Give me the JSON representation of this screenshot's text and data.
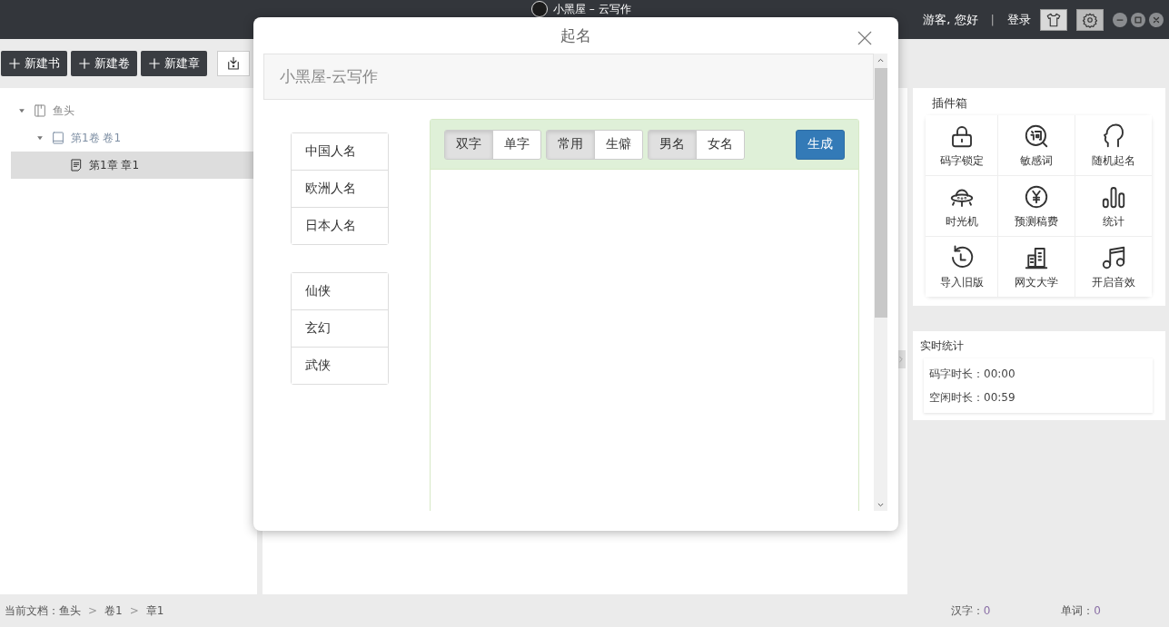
{
  "window": {
    "title": "小黑屋 – 云写作",
    "greeting": "游客, 您好",
    "separator": "|",
    "login": "登录"
  },
  "toolbar": [
    {
      "label": "新建书"
    },
    {
      "label": "新建卷"
    },
    {
      "label": "新建章"
    }
  ],
  "tree": [
    {
      "label": "鱼头",
      "kind": "book",
      "expanded": true,
      "selected": false,
      "children": [
        {
          "label": "第1卷 卷1",
          "kind": "volume",
          "expanded": true,
          "selected": false,
          "children": [
            {
              "label": "第1章 章1",
              "kind": "chapter",
              "selected": true
            }
          ]
        }
      ]
    }
  ],
  "plugins": {
    "title": "插件箱",
    "items": [
      {
        "label": "码字锁定",
        "kind": "lock"
      },
      {
        "label": "敏感词",
        "kind": "word"
      },
      {
        "label": "随机起名",
        "kind": "head"
      },
      {
        "label": "时光机",
        "kind": "ufo"
      },
      {
        "label": "预测稿费",
        "kind": "yen"
      },
      {
        "label": "统计",
        "kind": "bars"
      },
      {
        "label": "导入旧版",
        "kind": "history"
      },
      {
        "label": "网文大学",
        "kind": "building"
      },
      {
        "label": "开启音效",
        "kind": "music"
      }
    ]
  },
  "stats": {
    "title": "实时统计",
    "rows": [
      {
        "label": "码字时长：",
        "value": "00:00"
      },
      {
        "label": "空闲时长：",
        "value": "00:59"
      }
    ]
  },
  "status_bar": {
    "path_label": "当前文档：",
    "path": [
      "鱼头",
      "卷1",
      "章1"
    ],
    "separator": ">",
    "counts": [
      {
        "label": "汉字：",
        "value": "0"
      },
      {
        "label": "单词：",
        "value": "0"
      }
    ]
  },
  "dialog": {
    "title": "起名",
    "banner": "小黑屋-云写作",
    "lists": [
      [
        {
          "label": "中国人名",
          "selected": false
        },
        {
          "label": "欧洲人名",
          "selected": false
        },
        {
          "label": "日本人名",
          "selected": false
        }
      ],
      [
        {
          "label": "仙侠",
          "selected": false
        },
        {
          "label": "玄幻",
          "selected": false
        },
        {
          "label": "武侠",
          "selected": false
        }
      ]
    ],
    "toggle_groups": [
      [
        {
          "label": "双字",
          "selected": true
        },
        {
          "label": "单字",
          "selected": false
        }
      ],
      [
        {
          "label": "常用",
          "selected": true
        },
        {
          "label": "生僻",
          "selected": false
        }
      ],
      [
        {
          "label": "男名",
          "selected": true
        },
        {
          "label": "女名",
          "selected": false
        }
      ]
    ],
    "generate": "生成"
  }
}
